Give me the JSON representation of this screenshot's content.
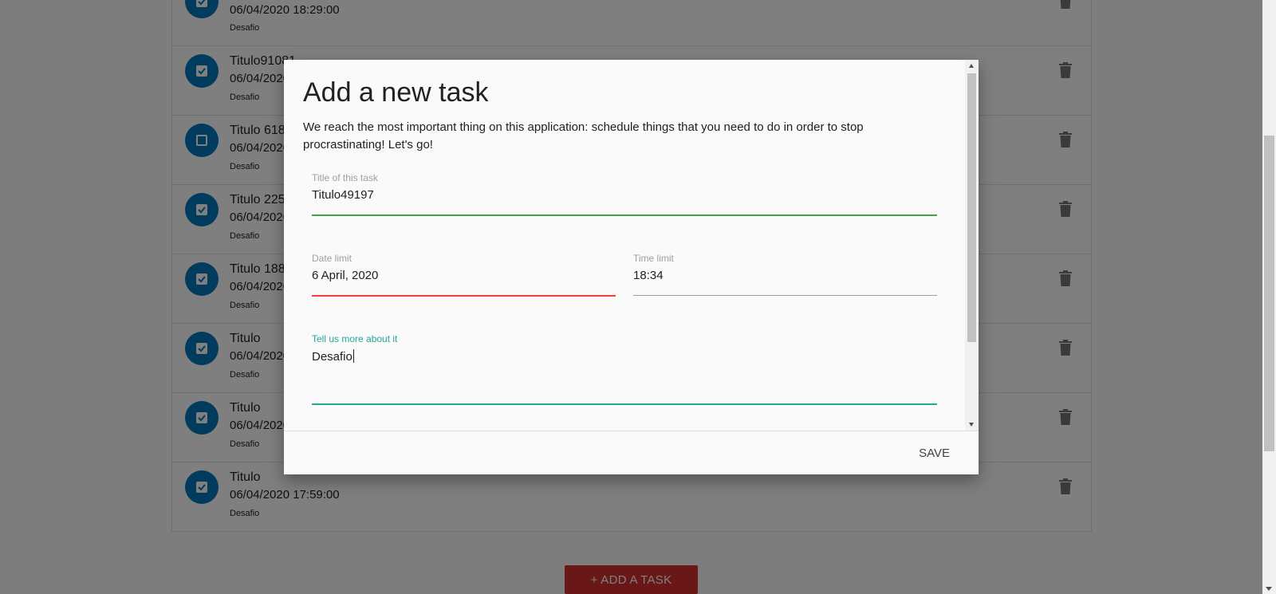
{
  "tasks": [
    {
      "title": "",
      "date": "06/04/2020 18:29:00",
      "description": "Desafio",
      "checked": true
    },
    {
      "title": "Titulo91081",
      "date": "06/04/2020",
      "description": "Desafio",
      "checked": true
    },
    {
      "title": "Titulo 618",
      "date": "06/04/2020",
      "description": "Desafio",
      "checked": false
    },
    {
      "title": "Titulo 225",
      "date": "06/04/2020",
      "description": "Desafio",
      "checked": true
    },
    {
      "title": "Titulo 188",
      "date": "06/04/2020",
      "description": "Desafio",
      "checked": true
    },
    {
      "title": "Titulo",
      "date": "06/04/2020",
      "description": "Desafio",
      "checked": true
    },
    {
      "title": "Titulo",
      "date": "06/04/2020",
      "description": "Desafio",
      "checked": true
    },
    {
      "title": "Titulo",
      "date": "06/04/2020 17:59:00",
      "description": "Desafio",
      "checked": true
    }
  ],
  "add_task_label": "+ ADD A TASK",
  "modal": {
    "title": "Add a new task",
    "description": "We reach the most important thing on this application: schedule things that you need to do in order to stop procrastinating! Let's go!",
    "fields": {
      "title": {
        "label": "Title of this task",
        "value": "Titulo49197"
      },
      "date": {
        "label": "Date limit",
        "value": "6 April, 2020"
      },
      "time": {
        "label": "Time limit",
        "value": "18:34"
      },
      "description": {
        "label": "Tell us more about it",
        "value": "Desafio"
      }
    },
    "save_label": "SAVE"
  },
  "colors": {
    "check_circle": "#0277bd",
    "add_button": "#d32f2f",
    "valid_line": "#43a047",
    "invalid_line": "#f44336",
    "focus_line": "#26a69a"
  }
}
